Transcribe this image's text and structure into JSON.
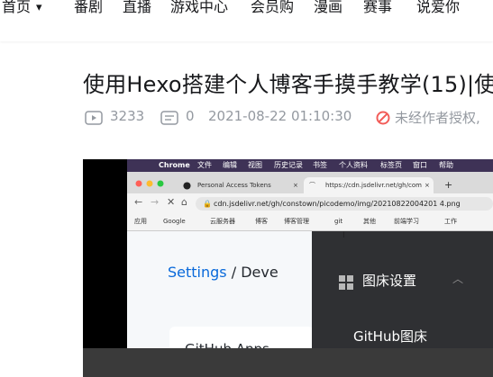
{
  "nav": {
    "items": [
      "首页",
      "番剧",
      "直播",
      "游戏中心",
      "会员购",
      "漫画",
      "赛事",
      "说爱你"
    ]
  },
  "article": {
    "title": "使用Hexo搭建个人博客手摸手教学(15)|使",
    "views": "3233",
    "comments": "0",
    "datetime": "2021-08-22 01:10:30",
    "copyright": "未经作者授权,"
  },
  "video": {
    "menubar": [
      "Chrome",
      "文件",
      "编辑",
      "视图",
      "历史记录",
      "书签",
      "个人资料",
      "标签页",
      "窗口",
      "帮助"
    ],
    "tab1": "Personal Access Tokens",
    "tab2": "https://cdn.jsdelivr.net/gh/com",
    "tab_close": "×",
    "new_tab": "+",
    "url": "cdn.jsdelivr.net/gh/constown/picodemo/img/20210822004201 4.png",
    "bookmarks": [
      "应用",
      "Google",
      "云服务器",
      "博客",
      "博客管理",
      "git",
      "其他",
      "前端学习",
      "工作"
    ],
    "settings_link": "Settings",
    "settings_rest": " / Deve",
    "github_apps": "GitHub Apps",
    "overlay_title": "图床设置",
    "overlay_sub": "GitHub图床"
  }
}
